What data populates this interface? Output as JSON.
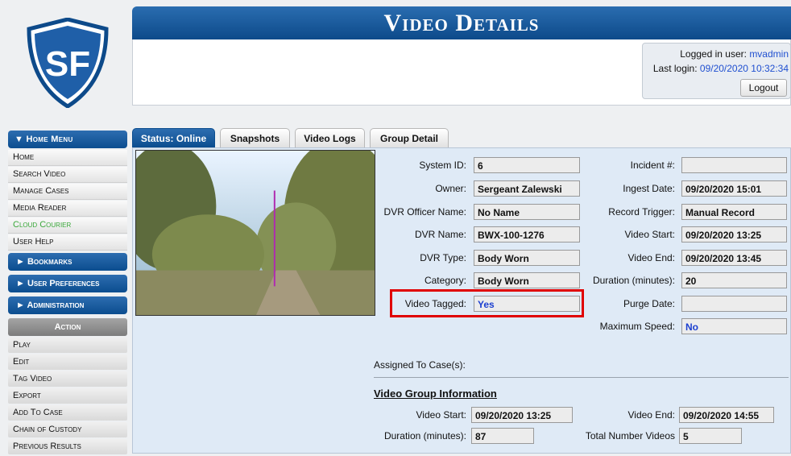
{
  "header": {
    "title": "Video Details",
    "login_label": "Logged in user:",
    "login_user": "mvadmin",
    "last_login_label": "Last login:",
    "last_login_value": "09/20/2020 10:32:34",
    "logout_label": "Logout"
  },
  "sidebar": {
    "home_menu": "▼ Home Menu",
    "items": [
      "Home",
      "Search Video",
      "Manage Cases",
      "Media Reader",
      "Cloud Courier",
      "User Help"
    ],
    "sections": [
      "► Bookmarks",
      "► User Preferences",
      "► Administration"
    ],
    "action_header": "Action",
    "actions": [
      "Play",
      "Edit",
      "Tag Video",
      "Export",
      "Add To Case",
      "Chain of Custody",
      "Previous Results"
    ]
  },
  "tabs": [
    "Status: Online",
    "Snapshots",
    "Video Logs",
    "Group Detail"
  ],
  "details_left": [
    {
      "label": "System ID:",
      "value": "6"
    },
    {
      "label": "Owner:",
      "value": "Sergeant Zalewski"
    },
    {
      "label": "DVR Officer Name:",
      "value": "No Name"
    },
    {
      "label": "DVR Name:",
      "value": "BWX-100-1276"
    },
    {
      "label": "DVR Type:",
      "value": "Body Worn"
    },
    {
      "label": "Category:",
      "value": "Body Worn"
    },
    {
      "label": "Video Tagged:",
      "value": "Yes"
    }
  ],
  "details_right": [
    {
      "label": "Incident #:",
      "value": ""
    },
    {
      "label": "Ingest Date:",
      "value": "09/20/2020 15:01"
    },
    {
      "label": "Record Trigger:",
      "value": "Manual Record"
    },
    {
      "label": "Video Start:",
      "value": "09/20/2020 13:25"
    },
    {
      "label": "Video End:",
      "value": "09/20/2020 13:45"
    },
    {
      "label": "Duration (minutes):",
      "value": "20"
    },
    {
      "label": "Purge Date:",
      "value": ""
    },
    {
      "label": "Maximum Speed:",
      "value": "No"
    }
  ],
  "assigned_cases_label": "Assigned To Case(s):",
  "group_info": {
    "title": "Video Group Information",
    "video_start_label": "Video Start:",
    "video_start": "09/20/2020 13:25",
    "video_end_label": "Video End:",
    "video_end": "09/20/2020 14:55",
    "duration_label": "Duration (minutes):",
    "duration": "87",
    "total_label": "Total Number Videos",
    "total": "5"
  },
  "colors": {
    "accent": "#0d4a8a",
    "highlight": "#e00000",
    "link": "#1f4fd0",
    "green": "#3aa83a"
  }
}
